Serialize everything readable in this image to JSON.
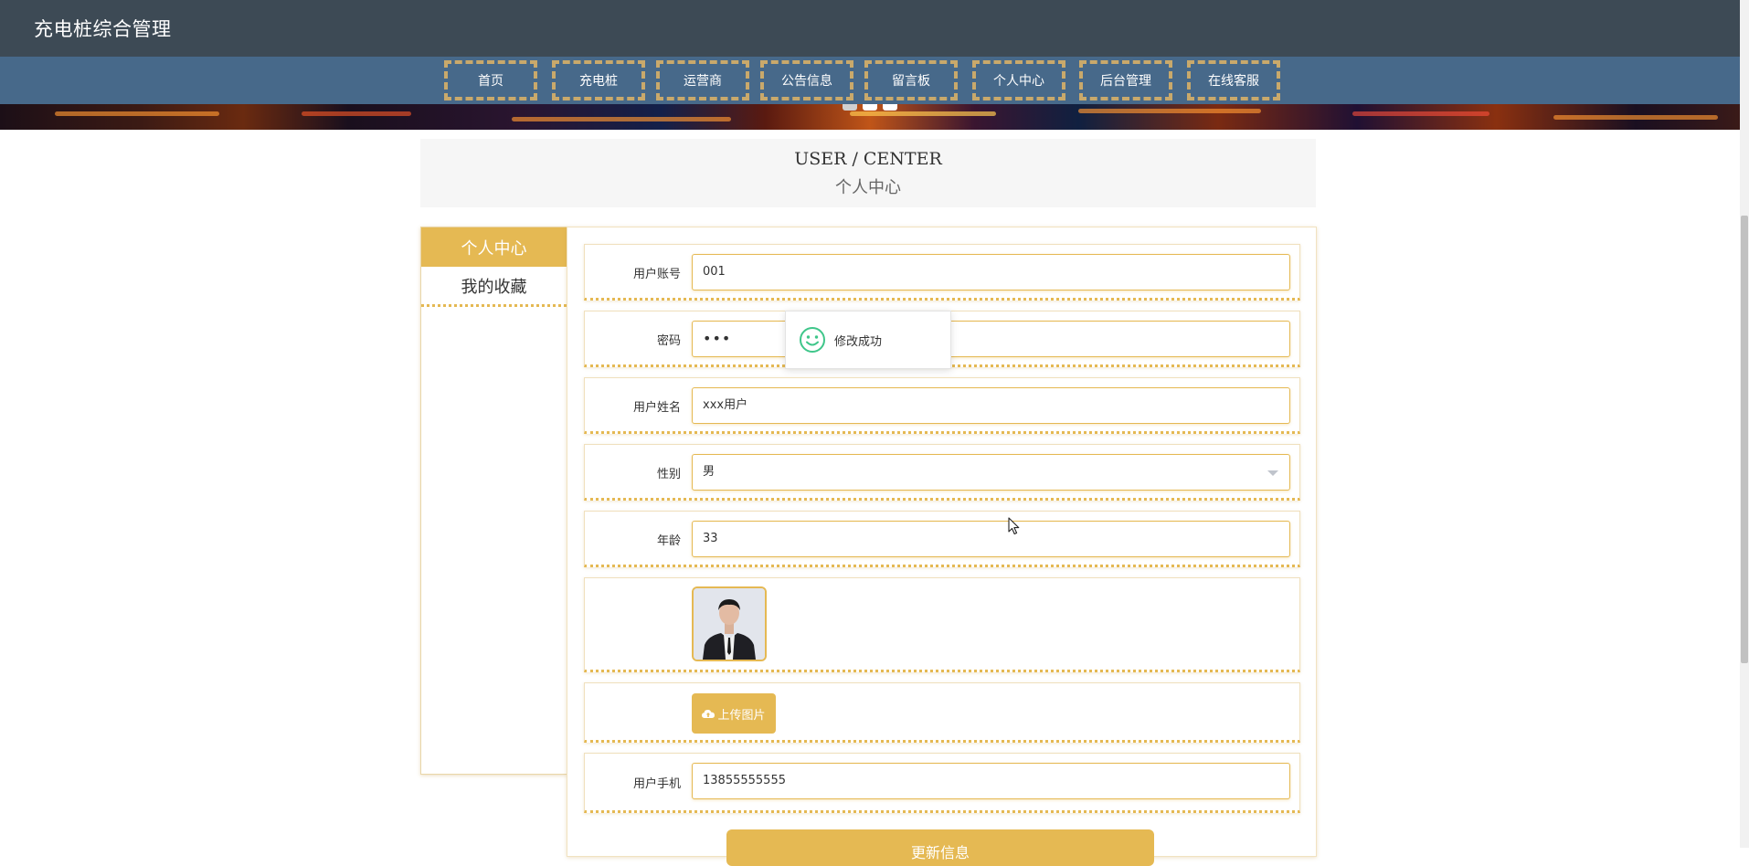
{
  "site": {
    "title": "充电桩综合管理"
  },
  "nav": {
    "items": [
      "首页",
      "充电桩",
      "运营商",
      "公告信息",
      "留言板",
      "个人中心",
      "后台管理",
      "在线客服"
    ]
  },
  "heading": {
    "en": "USER / CENTER",
    "cn": "个人中心"
  },
  "sidebar": {
    "items": [
      "个人中心",
      "我的收藏"
    ],
    "active": "个人中心"
  },
  "form": {
    "account": {
      "label": "用户账号",
      "value": "001"
    },
    "password": {
      "label": "密码",
      "value": "•••"
    },
    "name": {
      "label": "用户姓名",
      "value": "xxx用户"
    },
    "gender": {
      "label": "性别",
      "value": "男"
    },
    "age": {
      "label": "年龄",
      "value": "33"
    },
    "phone": {
      "label": "用户手机",
      "value": "13855555555"
    },
    "upload_label": "上传图片",
    "submit_label": "更新信息"
  },
  "toast": {
    "message": "修改成功"
  },
  "colors": {
    "accent": "#e5b953",
    "topbar": "#3d4a55",
    "navbar": "#47698a",
    "success": "#3fc68a"
  },
  "icons": {
    "toast": "smile-icon",
    "upload": "cloud-upload-icon",
    "select": "chevron-down-icon",
    "cursor": "mouse-cursor-icon"
  }
}
